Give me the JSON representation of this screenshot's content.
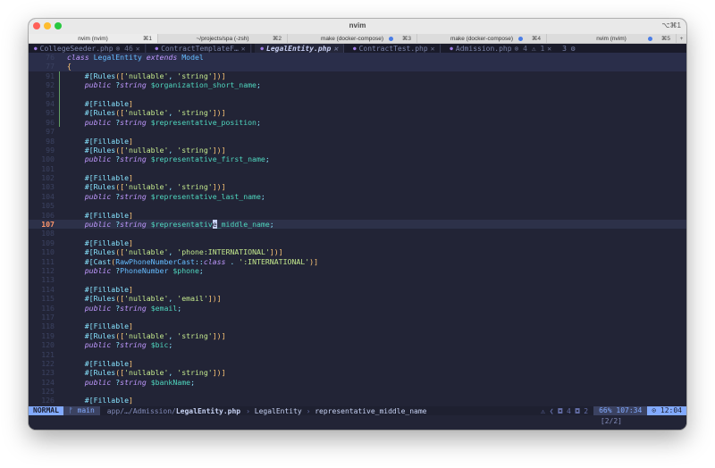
{
  "window": {
    "title": "nvim",
    "shortcut": "⌥⌘1",
    "tabs": [
      {
        "label": "nvim (nvim)",
        "key": "⌘1",
        "active": true,
        "dot": false
      },
      {
        "label": "~/projects/spa (-zsh)",
        "key": "⌘2",
        "active": false,
        "dot": false
      },
      {
        "label": "make (docker-compose)",
        "key": "⌘3",
        "active": false,
        "dot": true
      },
      {
        "label": "make (docker-compose)",
        "key": "⌘4",
        "active": false,
        "dot": true
      },
      {
        "label": "nvim (nvim)",
        "key": "⌘5",
        "active": false,
        "dot": true
      }
    ],
    "plus": "+"
  },
  "buffers": [
    {
      "icon": "●",
      "name": "CollegeSeeder.php",
      "diag": "⊗ 46",
      "close": "✕",
      "active": false
    },
    {
      "icon": "●",
      "name": "ContractTemplateF…",
      "diag": "",
      "close": "✕",
      "active": false
    },
    {
      "icon": "●",
      "name": "LegalEntity.php",
      "diag": "",
      "close": "✕",
      "active": true
    },
    {
      "icon": "●",
      "name": "ContractTest.php",
      "diag": "",
      "close": "✕",
      "active": false
    },
    {
      "icon": "●",
      "name": "Admission.php",
      "diag": "⊗ 4 ⚠ 1",
      "close": "✕",
      "active": false
    },
    {
      "icon": "",
      "name": "3 ⚙",
      "diag": "",
      "close": "",
      "active": false
    }
  ],
  "code": [
    {
      "n": "76",
      "cls": "hl",
      "t": "class LegalEntity extends Model"
    },
    {
      "n": "77",
      "cls": "hl",
      "t": "{"
    },
    {
      "n": "91",
      "t": "    #[Rules(['nullable', 'string'])]"
    },
    {
      "n": "92",
      "t": "    public ?string $organization_short_name;"
    },
    {
      "n": "93",
      "t": ""
    },
    {
      "n": "94",
      "t": "    #[Fillable]"
    },
    {
      "n": "95",
      "t": "    #[Rules(['nullable', 'string'])]"
    },
    {
      "n": "96",
      "t": "    public ?string $representative_position;"
    },
    {
      "n": "97",
      "t": ""
    },
    {
      "n": "98",
      "t": "    #[Fillable]"
    },
    {
      "n": "99",
      "t": "    #[Rules(['nullable', 'string'])]"
    },
    {
      "n": "100",
      "t": "    public ?string $representative_first_name;"
    },
    {
      "n": "101",
      "t": ""
    },
    {
      "n": "102",
      "t": "    #[Fillable]"
    },
    {
      "n": "103",
      "t": "    #[Rules(['nullable', 'string'])]"
    },
    {
      "n": "104",
      "t": "    public ?string $representative_last_name;"
    },
    {
      "n": "105",
      "t": ""
    },
    {
      "n": "106",
      "t": "    #[Fillable]"
    },
    {
      "n": "107",
      "cls": "cur",
      "t": "    public ?string $representative_middle_name;"
    },
    {
      "n": "108",
      "t": ""
    },
    {
      "n": "109",
      "t": "    #[Fillable]"
    },
    {
      "n": "110",
      "t": "    #[Rules(['nullable', 'phone:INTERNATIONAL'])]"
    },
    {
      "n": "111",
      "t": "    #[Cast(RawPhoneNumberCast::class . ':INTERNATIONAL')]"
    },
    {
      "n": "112",
      "t": "    public ?PhoneNumber $phone;"
    },
    {
      "n": "113",
      "t": ""
    },
    {
      "n": "114",
      "t": "    #[Fillable]"
    },
    {
      "n": "115",
      "t": "    #[Rules(['nullable', 'email'])]"
    },
    {
      "n": "116",
      "t": "    public ?string $email;"
    },
    {
      "n": "117",
      "t": ""
    },
    {
      "n": "118",
      "t": "    #[Fillable]"
    },
    {
      "n": "119",
      "t": "    #[Rules(['nullable', 'string'])]"
    },
    {
      "n": "120",
      "t": "    public ?string $bic;"
    },
    {
      "n": "121",
      "t": ""
    },
    {
      "n": "122",
      "t": "    #[Fillable]"
    },
    {
      "n": "123",
      "t": "    #[Rules(['nullable', 'string'])]"
    },
    {
      "n": "124",
      "t": "    public ?string $bankName;"
    },
    {
      "n": "125",
      "t": ""
    },
    {
      "n": "126",
      "t": "    #[Fillable]"
    }
  ],
  "status": {
    "mode": "NORMAL",
    "branch": "ᚠ main",
    "file_prefix": "app/…/Admission/",
    "file_name": "LegalEntity.php",
    "crumb_class": "LegalEntity",
    "crumb_prop": "representative_middle_name",
    "diag": "⚠ ❮ ◘ 4 ◘ 2",
    "position": "66% 107:34",
    "clock": "⊙ 12:04"
  },
  "cmdline": {
    "pager": "[2/2]"
  },
  "colors": {
    "accent": "#82aaff",
    "background": "#222436"
  }
}
